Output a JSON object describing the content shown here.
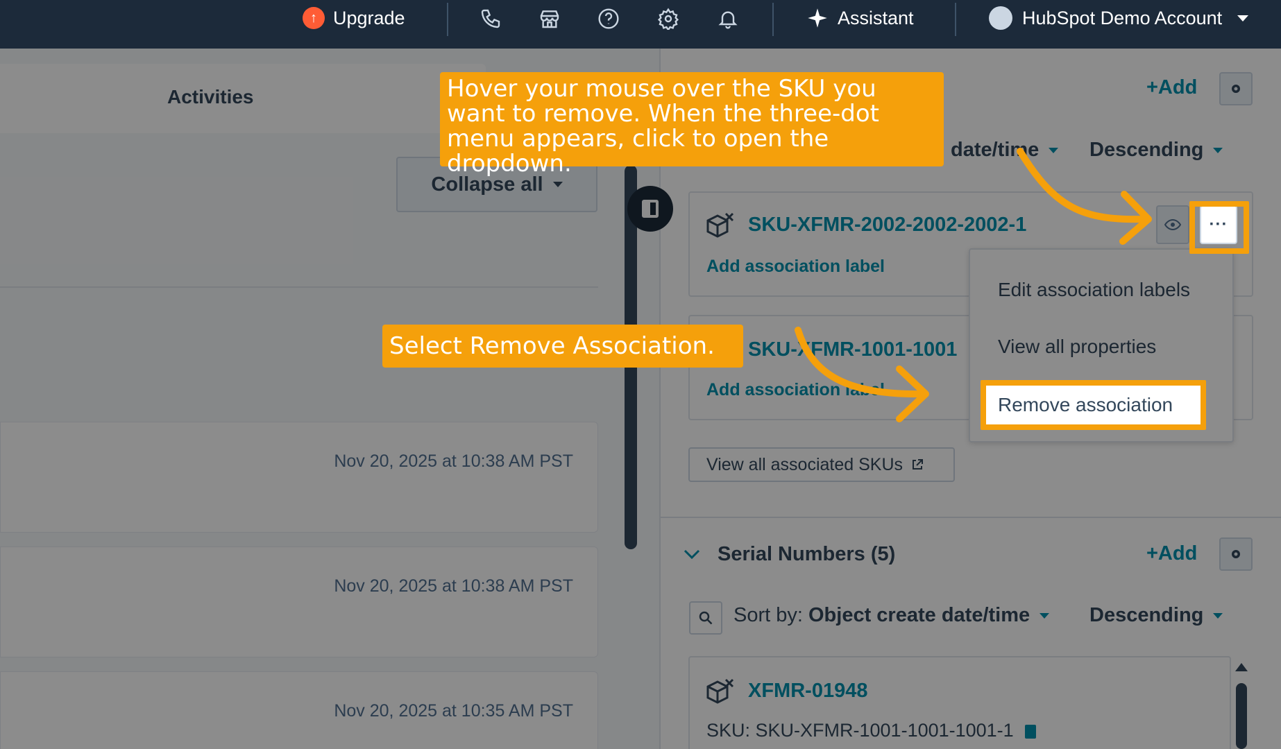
{
  "topnav": {
    "upgrade_label": "Upgrade",
    "assistant_label": "Assistant",
    "account_label": "HubSpot Demo Account",
    "icons": [
      "phone-icon",
      "marketplace-icon",
      "help-icon",
      "settings-icon",
      "notifications-icon"
    ]
  },
  "left": {
    "tab_label": "Activities",
    "collapse_label": "Collapse all",
    "activity_times": [
      "Nov 20, 2025 at 10:38 AM PST",
      "Nov 20, 2025 at 10:38 AM PST",
      "Nov 20, 2025 at 10:35 AM PST"
    ]
  },
  "skus_section": {
    "add_label": "+Add",
    "sort_field_partial": "date/time",
    "sort_order": "Descending",
    "records": [
      {
        "name": "SKU-XFMR-2002-2002-2002-1",
        "assoc_label": "Add association label"
      },
      {
        "name": "SKU-XFMR-1001-1001",
        "assoc_label": "Add association label"
      }
    ],
    "view_all_label": "View all associated SKUs"
  },
  "dropdown": {
    "items": [
      "Edit association labels",
      "View all properties",
      "Remove association"
    ]
  },
  "serial_section": {
    "title": "Serial Numbers (5)",
    "add_label": "+Add",
    "sort_prefix": "Sort by:",
    "sort_field": "Object create date/time",
    "sort_order": "Descending",
    "record": {
      "name": "XFMR-01948",
      "sku_line": "SKU: SKU-XFMR-1001-1001-1001-1"
    }
  },
  "callouts": {
    "hover_instruction": "Hover your mouse over the SKU you want to remove. When the three-dot menu appears, click to open the dropdown.",
    "select_instruction": "Select Remove Association."
  },
  "colors": {
    "callout": "#f5a00b",
    "nav_bg": "#1c2a3a",
    "link": "#0091ae"
  }
}
